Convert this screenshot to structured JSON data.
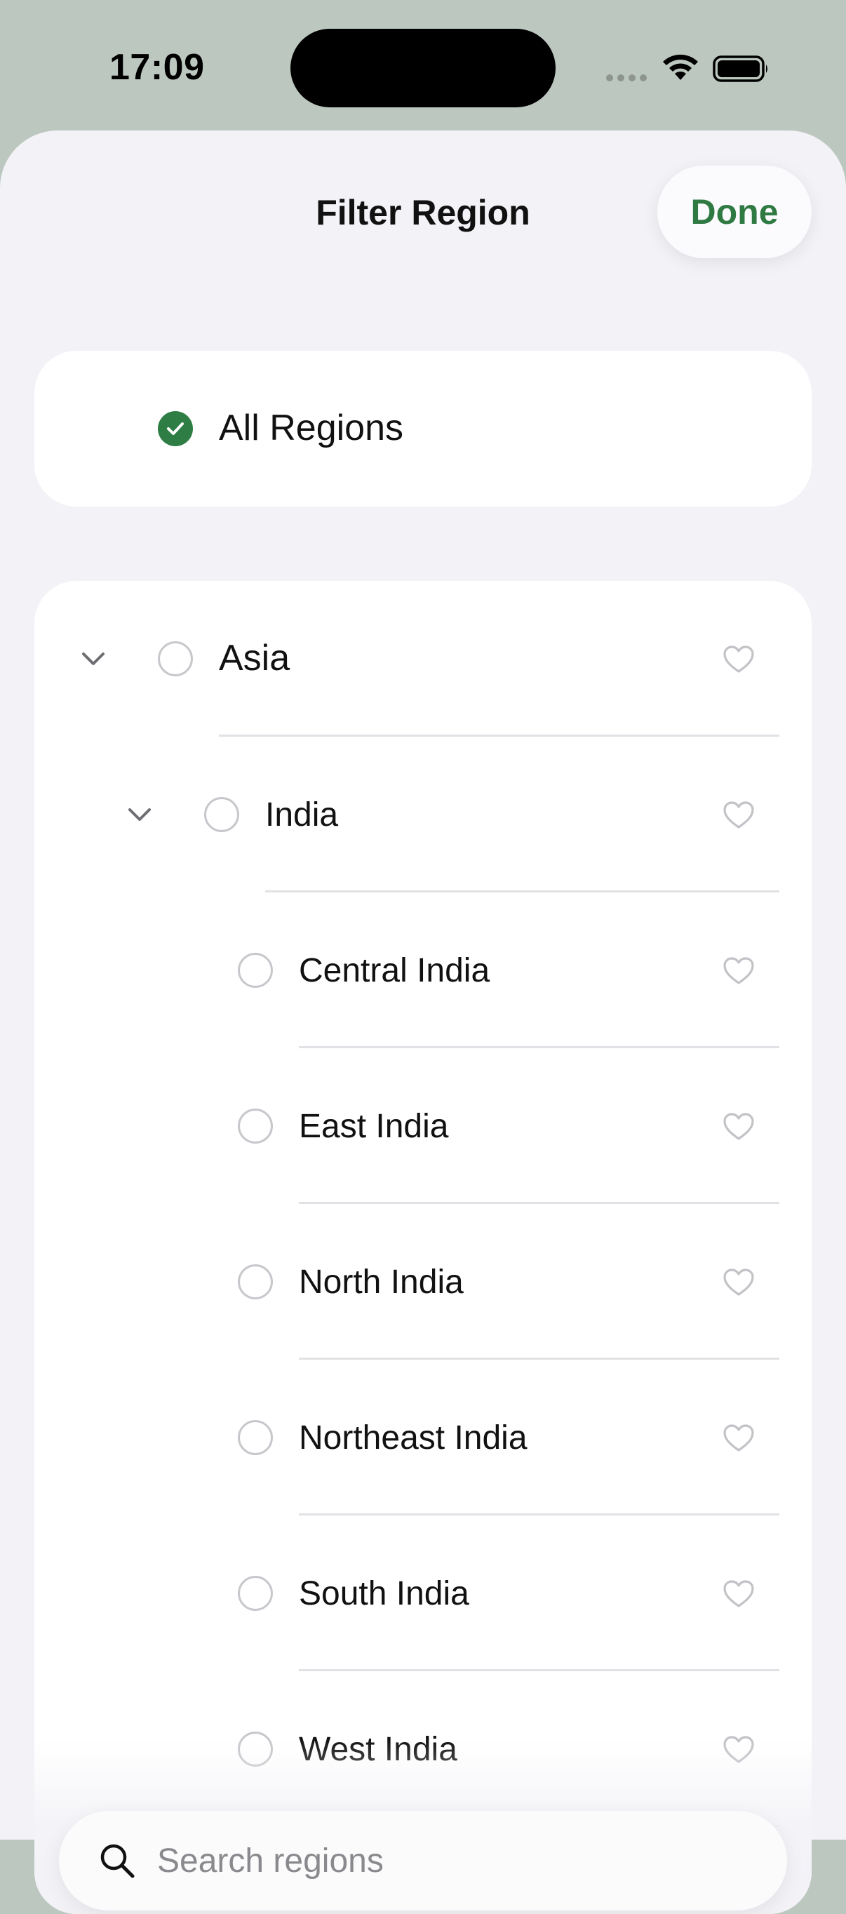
{
  "status_bar": {
    "time": "17:09"
  },
  "header": {
    "title": "Filter Region",
    "done_label": "Done"
  },
  "all_regions": {
    "label": "All Regions",
    "selected": true
  },
  "regions": [
    {
      "label": "Asia",
      "level": 0,
      "expandable": true,
      "expanded": true,
      "selected": false
    },
    {
      "label": "India",
      "level": 1,
      "expandable": true,
      "expanded": true,
      "selected": false
    },
    {
      "label": "Central India",
      "level": 2,
      "expandable": false,
      "selected": false
    },
    {
      "label": "East India",
      "level": 2,
      "expandable": false,
      "selected": false
    },
    {
      "label": "North India",
      "level": 2,
      "expandable": false,
      "selected": false
    },
    {
      "label": "Northeast India",
      "level": 2,
      "expandable": false,
      "selected": false
    },
    {
      "label": "South India",
      "level": 2,
      "expandable": false,
      "selected": false
    },
    {
      "label": "West India",
      "level": 2,
      "expandable": false,
      "selected": false
    }
  ],
  "search": {
    "placeholder": "Search regions",
    "value": ""
  },
  "icons": {
    "check": "checkmark-icon",
    "chevron": "chevron-down-icon",
    "favorite": "heart-icon",
    "search": "magnifying-glass-icon"
  },
  "colors": {
    "accent": "#2e7d44",
    "done_text": "#2f7a43",
    "background_top": "#bcc8bf",
    "sheet": "#f2f2f7"
  }
}
